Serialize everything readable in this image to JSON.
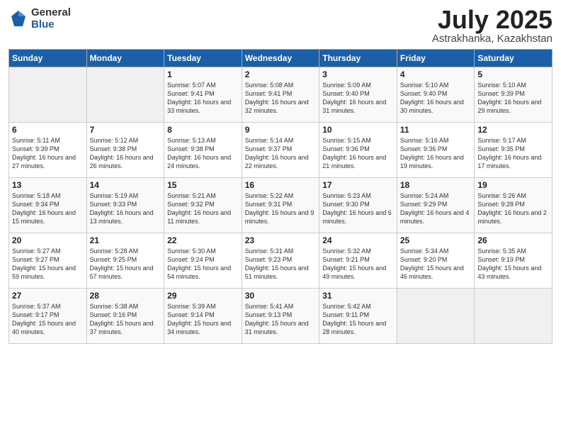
{
  "header": {
    "logo_general": "General",
    "logo_blue": "Blue",
    "month": "July 2025",
    "location": "Astrakhanka, Kazakhstan"
  },
  "days_of_week": [
    "Sunday",
    "Monday",
    "Tuesday",
    "Wednesday",
    "Thursday",
    "Friday",
    "Saturday"
  ],
  "weeks": [
    [
      {
        "day": "",
        "sunrise": "",
        "sunset": "",
        "daylight": ""
      },
      {
        "day": "",
        "sunrise": "",
        "sunset": "",
        "daylight": ""
      },
      {
        "day": "1",
        "sunrise": "Sunrise: 5:07 AM",
        "sunset": "Sunset: 9:41 PM",
        "daylight": "Daylight: 16 hours and 33 minutes."
      },
      {
        "day": "2",
        "sunrise": "Sunrise: 5:08 AM",
        "sunset": "Sunset: 9:41 PM",
        "daylight": "Daylight: 16 hours and 32 minutes."
      },
      {
        "day": "3",
        "sunrise": "Sunrise: 5:09 AM",
        "sunset": "Sunset: 9:40 PM",
        "daylight": "Daylight: 16 hours and 31 minutes."
      },
      {
        "day": "4",
        "sunrise": "Sunrise: 5:10 AM",
        "sunset": "Sunset: 9:40 PM",
        "daylight": "Daylight: 16 hours and 30 minutes."
      },
      {
        "day": "5",
        "sunrise": "Sunrise: 5:10 AM",
        "sunset": "Sunset: 9:39 PM",
        "daylight": "Daylight: 16 hours and 29 minutes."
      }
    ],
    [
      {
        "day": "6",
        "sunrise": "Sunrise: 5:11 AM",
        "sunset": "Sunset: 9:39 PM",
        "daylight": "Daylight: 16 hours and 27 minutes."
      },
      {
        "day": "7",
        "sunrise": "Sunrise: 5:12 AM",
        "sunset": "Sunset: 9:38 PM",
        "daylight": "Daylight: 16 hours and 26 minutes."
      },
      {
        "day": "8",
        "sunrise": "Sunrise: 5:13 AM",
        "sunset": "Sunset: 9:38 PM",
        "daylight": "Daylight: 16 hours and 24 minutes."
      },
      {
        "day": "9",
        "sunrise": "Sunrise: 5:14 AM",
        "sunset": "Sunset: 9:37 PM",
        "daylight": "Daylight: 16 hours and 22 minutes."
      },
      {
        "day": "10",
        "sunrise": "Sunrise: 5:15 AM",
        "sunset": "Sunset: 9:36 PM",
        "daylight": "Daylight: 16 hours and 21 minutes."
      },
      {
        "day": "11",
        "sunrise": "Sunrise: 5:16 AM",
        "sunset": "Sunset: 9:36 PM",
        "daylight": "Daylight: 16 hours and 19 minutes."
      },
      {
        "day": "12",
        "sunrise": "Sunrise: 5:17 AM",
        "sunset": "Sunset: 9:35 PM",
        "daylight": "Daylight: 16 hours and 17 minutes."
      }
    ],
    [
      {
        "day": "13",
        "sunrise": "Sunrise: 5:18 AM",
        "sunset": "Sunset: 9:34 PM",
        "daylight": "Daylight: 16 hours and 15 minutes."
      },
      {
        "day": "14",
        "sunrise": "Sunrise: 5:19 AM",
        "sunset": "Sunset: 9:33 PM",
        "daylight": "Daylight: 16 hours and 13 minutes."
      },
      {
        "day": "15",
        "sunrise": "Sunrise: 5:21 AM",
        "sunset": "Sunset: 9:32 PM",
        "daylight": "Daylight: 16 hours and 11 minutes."
      },
      {
        "day": "16",
        "sunrise": "Sunrise: 5:22 AM",
        "sunset": "Sunset: 9:31 PM",
        "daylight": "Daylight: 16 hours and 9 minutes."
      },
      {
        "day": "17",
        "sunrise": "Sunrise: 5:23 AM",
        "sunset": "Sunset: 9:30 PM",
        "daylight": "Daylight: 16 hours and 6 minutes."
      },
      {
        "day": "18",
        "sunrise": "Sunrise: 5:24 AM",
        "sunset": "Sunset: 9:29 PM",
        "daylight": "Daylight: 16 hours and 4 minutes."
      },
      {
        "day": "19",
        "sunrise": "Sunrise: 5:26 AM",
        "sunset": "Sunset: 9:28 PM",
        "daylight": "Daylight: 16 hours and 2 minutes."
      }
    ],
    [
      {
        "day": "20",
        "sunrise": "Sunrise: 5:27 AM",
        "sunset": "Sunset: 9:27 PM",
        "daylight": "Daylight: 15 hours and 59 minutes."
      },
      {
        "day": "21",
        "sunrise": "Sunrise: 5:28 AM",
        "sunset": "Sunset: 9:25 PM",
        "daylight": "Daylight: 15 hours and 57 minutes."
      },
      {
        "day": "22",
        "sunrise": "Sunrise: 5:30 AM",
        "sunset": "Sunset: 9:24 PM",
        "daylight": "Daylight: 15 hours and 54 minutes."
      },
      {
        "day": "23",
        "sunrise": "Sunrise: 5:31 AM",
        "sunset": "Sunset: 9:23 PM",
        "daylight": "Daylight: 15 hours and 51 minutes."
      },
      {
        "day": "24",
        "sunrise": "Sunrise: 5:32 AM",
        "sunset": "Sunset: 9:21 PM",
        "daylight": "Daylight: 15 hours and 49 minutes."
      },
      {
        "day": "25",
        "sunrise": "Sunrise: 5:34 AM",
        "sunset": "Sunset: 9:20 PM",
        "daylight": "Daylight: 15 hours and 46 minutes."
      },
      {
        "day": "26",
        "sunrise": "Sunrise: 5:35 AM",
        "sunset": "Sunset: 9:19 PM",
        "daylight": "Daylight: 15 hours and 43 minutes."
      }
    ],
    [
      {
        "day": "27",
        "sunrise": "Sunrise: 5:37 AM",
        "sunset": "Sunset: 9:17 PM",
        "daylight": "Daylight: 15 hours and 40 minutes."
      },
      {
        "day": "28",
        "sunrise": "Sunrise: 5:38 AM",
        "sunset": "Sunset: 9:16 PM",
        "daylight": "Daylight: 15 hours and 37 minutes."
      },
      {
        "day": "29",
        "sunrise": "Sunrise: 5:39 AM",
        "sunset": "Sunset: 9:14 PM",
        "daylight": "Daylight: 15 hours and 34 minutes."
      },
      {
        "day": "30",
        "sunrise": "Sunrise: 5:41 AM",
        "sunset": "Sunset: 9:13 PM",
        "daylight": "Daylight: 15 hours and 31 minutes."
      },
      {
        "day": "31",
        "sunrise": "Sunrise: 5:42 AM",
        "sunset": "Sunset: 9:11 PM",
        "daylight": "Daylight: 15 hours and 28 minutes."
      },
      {
        "day": "",
        "sunrise": "",
        "sunset": "",
        "daylight": ""
      },
      {
        "day": "",
        "sunrise": "",
        "sunset": "",
        "daylight": ""
      }
    ]
  ]
}
